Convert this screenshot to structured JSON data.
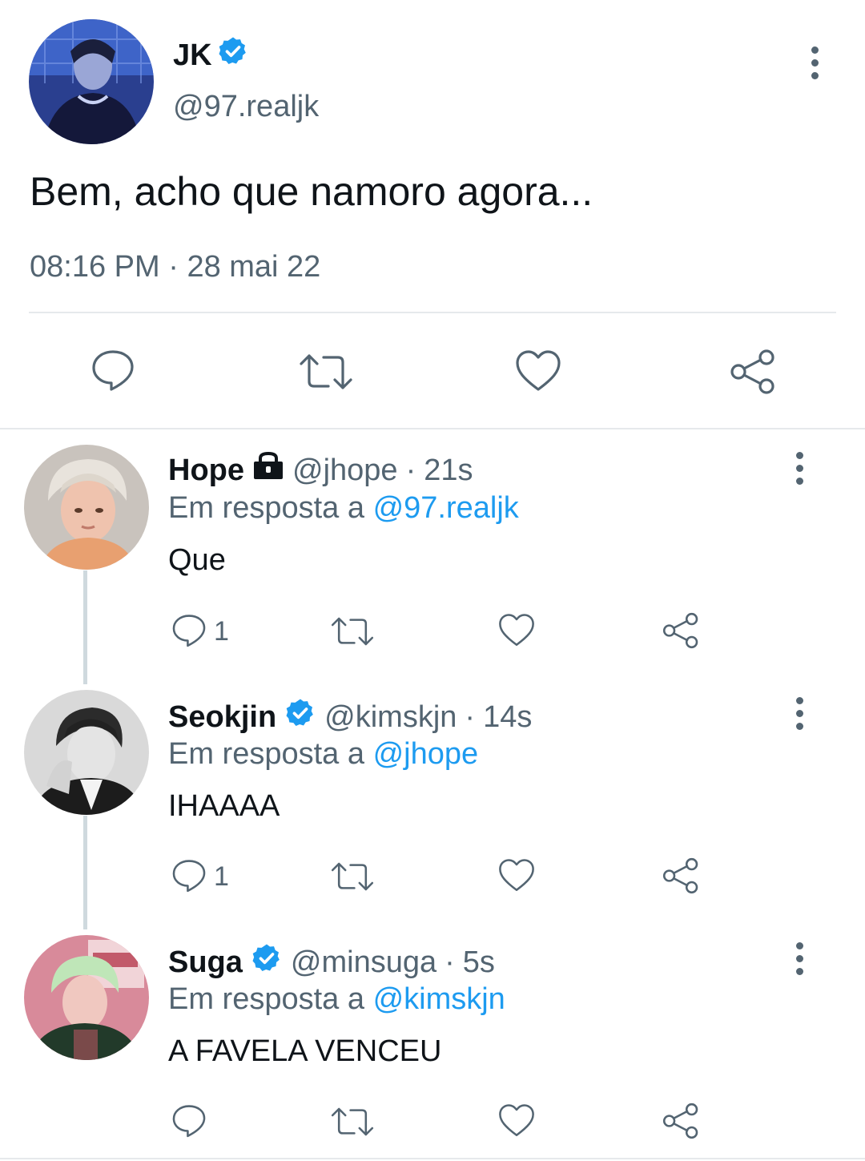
{
  "main_tweet": {
    "name": "JK",
    "handle": "@97.realjk",
    "verified": true,
    "text": "Bem, acho que namoro agora...",
    "time": "08:16 PM",
    "separator": "·",
    "date": "28 mai 22"
  },
  "replies": [
    {
      "name": "Hope",
      "badge": "lock-icon",
      "handle": "@jhope",
      "ago": "21s",
      "reply_prefix": "Em resposta a",
      "reply_to": "@97.realjk",
      "text": "Que",
      "reply_count": "1"
    },
    {
      "name": "Seokjin",
      "badge": "verified-icon",
      "handle": "@kimskjn",
      "ago": "14s",
      "reply_prefix": "Em resposta a",
      "reply_to": "@jhope",
      "text": "IHAAAA",
      "reply_count": "1"
    },
    {
      "name": "Suga",
      "badge": "verified-icon",
      "handle": "@minsuga",
      "ago": "5s",
      "reply_prefix": "Em resposta a",
      "reply_to": "@kimskjn",
      "text": "A FAVELA VENCEU",
      "reply_count": ""
    }
  ],
  "colors": {
    "accent": "#1d9bf0",
    "secondary_text": "#536471",
    "primary_text": "#0f1419",
    "divider": "#e6e9ec"
  }
}
